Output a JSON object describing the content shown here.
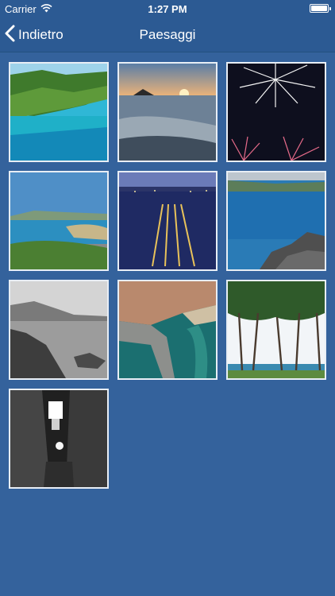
{
  "status_bar": {
    "carrier": "Carrier",
    "time": "1:27 PM",
    "wifi_icon": "wifi-icon",
    "battery_icon": "battery-icon"
  },
  "nav": {
    "back_label": "Indietro",
    "back_icon": "chevron-left-icon",
    "title": "Paesaggi"
  },
  "colors": {
    "background": "#34629c",
    "nav_background": "#2c5a93",
    "thumb_border": "#e8eef5"
  },
  "gallery": [
    {
      "subject": "green-coastal-cove"
    },
    {
      "subject": "sunset-over-sea"
    },
    {
      "subject": "fireworks"
    },
    {
      "subject": "bay-panorama"
    },
    {
      "subject": "marina-at-night"
    },
    {
      "subject": "blue-sea-rocks"
    },
    {
      "subject": "black-white-rocky-coast"
    },
    {
      "subject": "aerial-harbor-town"
    },
    {
      "subject": "pine-trees-by-sea"
    },
    {
      "subject": "black-white-alley-night"
    }
  ]
}
